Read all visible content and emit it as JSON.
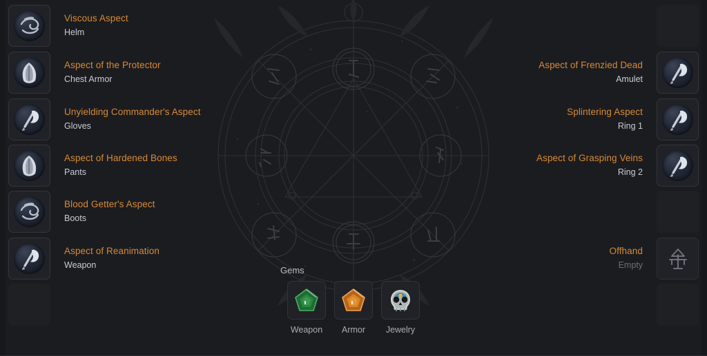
{
  "theme": {
    "background": "#1b1c20",
    "gutter": "#17181c",
    "slot_bg": "#212227",
    "slot_border": "#34353d",
    "aspect_color": "#d88a37",
    "slot_label_color": "#c9ccd4",
    "empty_label_color": "#6d7078"
  },
  "left_column": [
    {
      "aspect": "Viscous Aspect",
      "slot": "Helm",
      "icon": "helm-orb-icon",
      "state": "filled"
    },
    {
      "aspect": "Aspect of the Protector",
      "slot": "Chest Armor",
      "icon": "chest-orb-icon",
      "state": "filled"
    },
    {
      "aspect": "Unyielding Commander's Aspect",
      "slot": "Gloves",
      "icon": "axe-orb-icon",
      "state": "filled"
    },
    {
      "aspect": "Aspect of Hardened Bones",
      "slot": "Pants",
      "icon": "chest-orb-icon",
      "state": "filled"
    },
    {
      "aspect": "Blood Getter's Aspect",
      "slot": "Boots",
      "icon": "helm-orb-icon",
      "state": "filled"
    },
    {
      "aspect": "Aspect of Reanimation",
      "slot": "Weapon",
      "icon": "axe-orb-icon",
      "state": "filled"
    },
    {
      "aspect": "",
      "slot": "",
      "icon": "",
      "state": "empty"
    }
  ],
  "right_column": [
    {
      "aspect": "",
      "slot": "",
      "icon": "",
      "state": "empty"
    },
    {
      "aspect": "Aspect of Frenzied Dead",
      "slot": "Amulet",
      "icon": "axe-orb-icon",
      "state": "filled"
    },
    {
      "aspect": "Splintering Aspect",
      "slot": "Ring 1",
      "icon": "axe-orb-icon",
      "state": "filled"
    },
    {
      "aspect": "Aspect of Grasping Veins",
      "slot": "Ring 2",
      "icon": "axe-orb-icon",
      "state": "filled"
    },
    {
      "aspect": "",
      "slot": "",
      "icon": "",
      "state": "empty"
    },
    {
      "aspect": "Offhand",
      "slot": "Empty",
      "icon": "offhand-glyph-icon",
      "state": "placeholder"
    },
    {
      "aspect": "",
      "slot": "",
      "icon": "",
      "state": "empty"
    }
  ],
  "gems": {
    "title": "Gems",
    "items": [
      {
        "label": "Weapon",
        "icon": "green-gem-icon",
        "color": "#2f8a45"
      },
      {
        "label": "Armor",
        "icon": "orange-gem-icon",
        "color": "#e08a2a"
      },
      {
        "label": "Jewelry",
        "icon": "skull-gem-icon",
        "color": "#b9c3c4"
      }
    ]
  }
}
